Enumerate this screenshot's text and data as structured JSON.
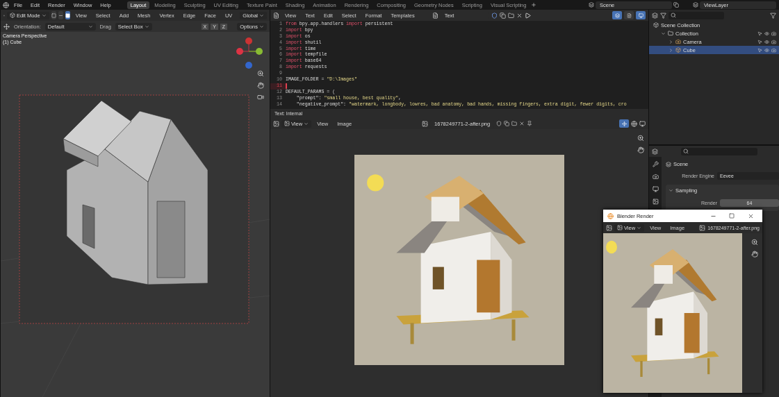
{
  "menu": [
    "File",
    "Edit",
    "Render",
    "Window",
    "Help"
  ],
  "workspaces": [
    {
      "label": "Layout",
      "selected": true
    },
    {
      "label": "Modeling",
      "selected": false
    },
    {
      "label": "Sculpting",
      "selected": false
    },
    {
      "label": "UV Editing",
      "selected": false
    },
    {
      "label": "Texture Paint",
      "selected": false
    },
    {
      "label": "Shading",
      "selected": false
    },
    {
      "label": "Animation",
      "selected": false
    },
    {
      "label": "Rendering",
      "selected": false
    },
    {
      "label": "Compositing",
      "selected": false
    },
    {
      "label": "Geometry Nodes",
      "selected": false
    },
    {
      "label": "Scripting",
      "selected": false
    },
    {
      "label": "Visual Scripting",
      "selected": false
    }
  ],
  "scene": "Scene",
  "view_layer": "ViewLayer",
  "viewport": {
    "mode": "Edit Mode",
    "menus": [
      "View",
      "Select",
      "Add",
      "Mesh",
      "Vertex",
      "Edge",
      "Face",
      "UV"
    ],
    "transform": "Global",
    "orientation_label": "Orientation:",
    "orientation": "Default",
    "drag_label": "Drag",
    "drag": "Select Box",
    "axes": [
      "X",
      "Y",
      "Z"
    ],
    "options": "Options",
    "overlay": [
      "Camera Perspective",
      "(1) Cube"
    ]
  },
  "text_editor": {
    "menus": [
      "View",
      "Text",
      "Edit",
      "Select",
      "Format",
      "Templates"
    ],
    "datablock": "Text",
    "footer": "Text: Internal",
    "lines": [
      {
        "number": "1",
        "current": false,
        "tokens": [
          {
            "text": "from",
            "kind": "keyword"
          },
          {
            "text": " bpy.app.handlers ",
            "kind": "plain"
          },
          {
            "text": "import",
            "kind": "keyword"
          },
          {
            "text": " persistent",
            "kind": "plain"
          }
        ]
      },
      {
        "number": "2",
        "current": false,
        "tokens": [
          {
            "text": "import",
            "kind": "keyword"
          },
          {
            "text": " bpy",
            "kind": "plain"
          }
        ]
      },
      {
        "number": "3",
        "current": false,
        "tokens": [
          {
            "text": "import",
            "kind": "keyword"
          },
          {
            "text": " os",
            "kind": "plain"
          }
        ]
      },
      {
        "number": "4",
        "current": false,
        "tokens": [
          {
            "text": "import",
            "kind": "keyword"
          },
          {
            "text": " shutil",
            "kind": "plain"
          }
        ]
      },
      {
        "number": "5",
        "current": false,
        "tokens": [
          {
            "text": "import",
            "kind": "keyword"
          },
          {
            "text": " time",
            "kind": "plain"
          }
        ]
      },
      {
        "number": "6",
        "current": false,
        "tokens": [
          {
            "text": "import",
            "kind": "keyword"
          },
          {
            "text": " tempfile",
            "kind": "plain"
          }
        ]
      },
      {
        "number": "7",
        "current": false,
        "tokens": [
          {
            "text": "import",
            "kind": "keyword"
          },
          {
            "text": " base64",
            "kind": "plain"
          }
        ]
      },
      {
        "number": "8",
        "current": false,
        "tokens": [
          {
            "text": "import",
            "kind": "keyword"
          },
          {
            "text": " requests",
            "kind": "plain"
          }
        ]
      },
      {
        "number": "9",
        "current": false
      },
      {
        "number": "10",
        "current": false,
        "tokens": [
          {
            "text": "IMAGE_FOLDER ",
            "kind": "plain"
          },
          {
            "text": "=",
            "kind": "operator"
          },
          {
            "text": " \"D:\\Images\"",
            "kind": "string"
          }
        ]
      },
      {
        "number": "11",
        "current": true
      },
      {
        "number": "12",
        "current": false,
        "tokens": [
          {
            "text": "DEFAULT_PARAMS ",
            "kind": "plain"
          },
          {
            "text": "= (",
            "kind": "operator"
          }
        ]
      },
      {
        "number": "13",
        "current": false,
        "tokens": [
          {
            "text": "    \"prompt\": ",
            "kind": "plain"
          },
          {
            "text": "\"small house, best quality\"",
            "kind": "string"
          },
          {
            "text": ",",
            "kind": "plain"
          }
        ]
      },
      {
        "number": "14",
        "current": false,
        "tokens": [
          {
            "text": "    \"negative_prompt\": ",
            "kind": "plain"
          },
          {
            "text": "\"watermark, longbody, lowres, bad anatomy, bad hands, missing fingers, extra digit, fewer digits, cro",
            "kind": "string"
          }
        ]
      }
    ]
  },
  "image_editor": {
    "view_dropdown": "View",
    "menus": [
      "View",
      "Image"
    ],
    "image_name": "1678249771-2-after.png"
  },
  "outliner": {
    "root": "Scene Collection",
    "items": [
      {
        "label": "Collection",
        "kind": "collection",
        "expanded": true,
        "selected": false,
        "children": [
          {
            "label": "Camera",
            "kind": "camera",
            "expanded": false,
            "selected": false
          },
          {
            "label": "Cube",
            "kind": "mesh",
            "expanded": false,
            "selected": true
          }
        ]
      }
    ]
  },
  "properties": {
    "title": "Scene",
    "fields": [
      {
        "label": "Render Engine",
        "value": "Eevee"
      }
    ],
    "panels": [
      {
        "title": "Sampling",
        "expanded": true,
        "fields": [
          {
            "label": "Render",
            "value": "64"
          }
        ]
      }
    ]
  },
  "render_window": {
    "title": "Blender Render",
    "view_dropdown": "View",
    "menus": [
      "View",
      "Image"
    ],
    "image_name": "1678249771-2-after.png"
  }
}
